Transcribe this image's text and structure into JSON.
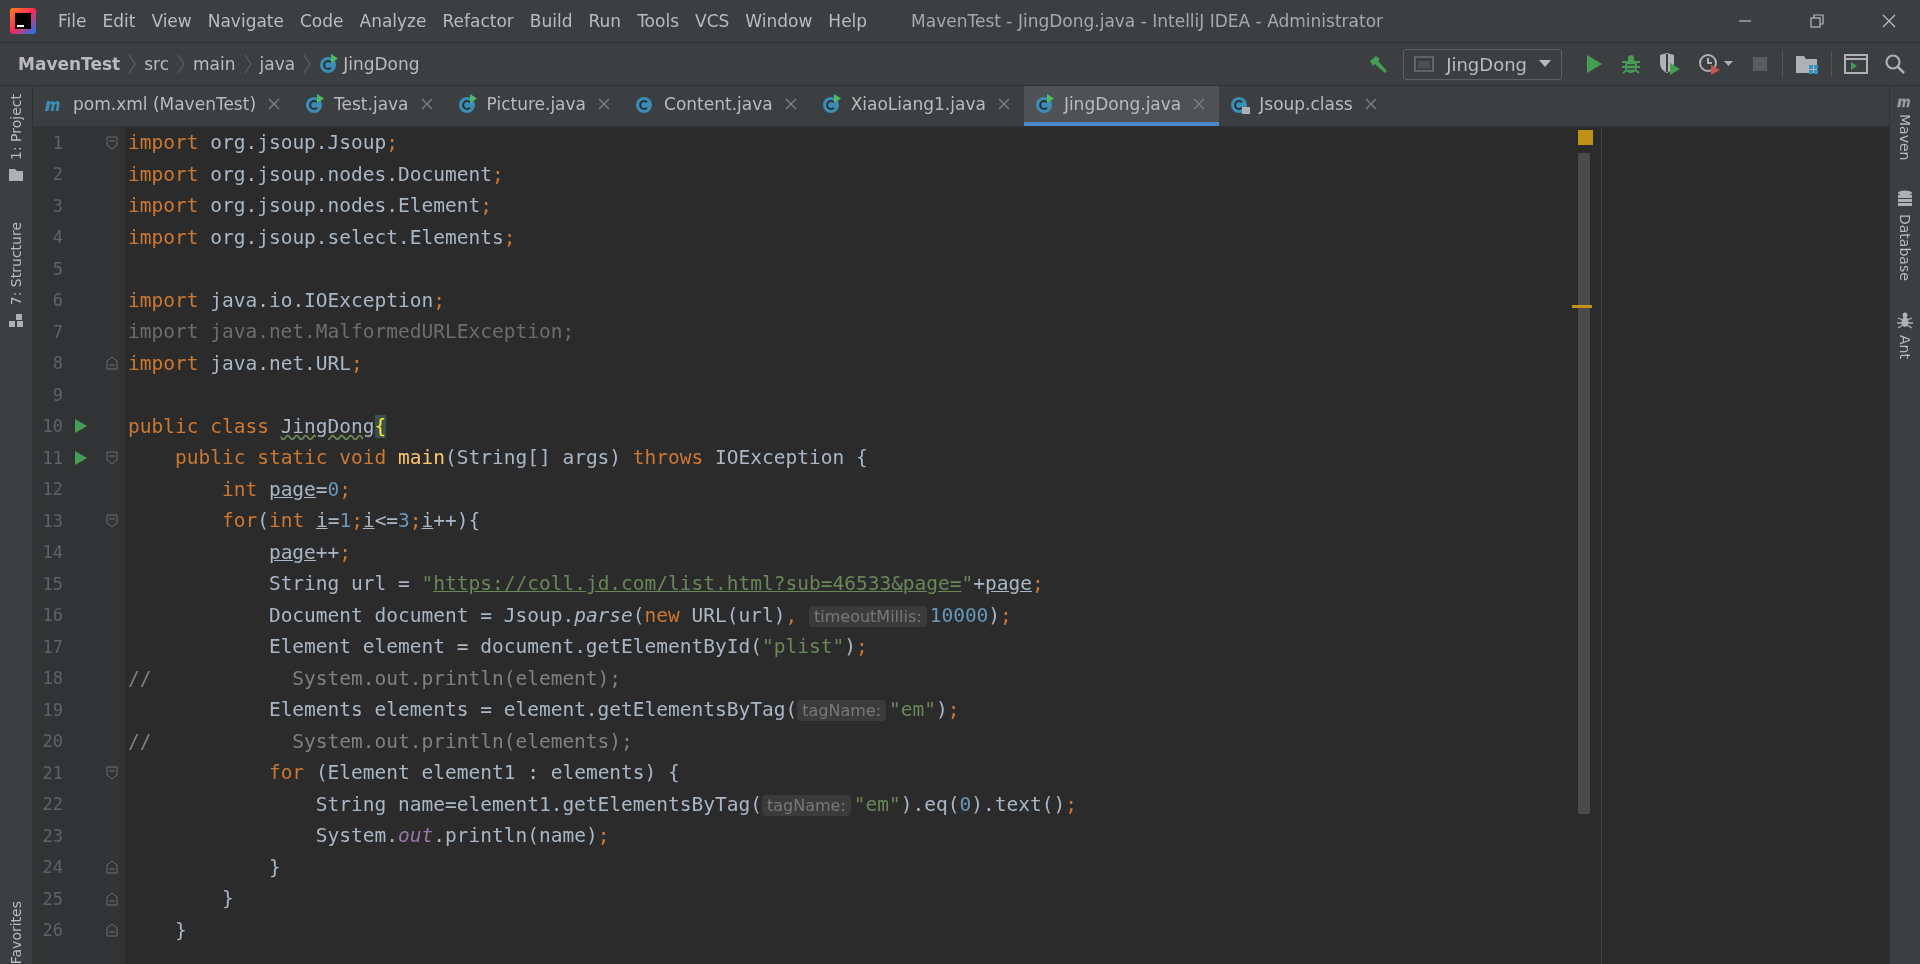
{
  "menu": [
    "File",
    "Edit",
    "View",
    "Navigate",
    "Code",
    "Analyze",
    "Refactor",
    "Build",
    "Run",
    "Tools",
    "VCS",
    "Window",
    "Help"
  ],
  "window_title": "MavenTest - JingDong.java - IntelliJ IDEA - Administrator",
  "breadcrumbs": [
    {
      "label": "MavenTest",
      "kind": "project"
    },
    {
      "label": "src",
      "kind": "folder"
    },
    {
      "label": "main",
      "kind": "folder"
    },
    {
      "label": "java",
      "kind": "folder"
    },
    {
      "label": "JingDong",
      "kind": "class"
    }
  ],
  "run_config": "JingDong",
  "tabs": [
    {
      "label": "pom.xml (MavenTest)",
      "kind": "maven",
      "selected": false
    },
    {
      "label": "Test.java",
      "kind": "runnable",
      "selected": false
    },
    {
      "label": "Picture.java",
      "kind": "runnable",
      "selected": false
    },
    {
      "label": "Content.java",
      "kind": "class",
      "selected": false
    },
    {
      "label": "XiaoLiang1.java",
      "kind": "runnable",
      "selected": false
    },
    {
      "label": "JingDong.java",
      "kind": "runnable",
      "selected": true
    },
    {
      "label": "Jsoup.class",
      "kind": "locked",
      "selected": false
    }
  ],
  "left_tools": [
    {
      "label": "1: Project",
      "kind": "folder"
    },
    {
      "label": "7: Structure",
      "kind": "structure"
    }
  ],
  "left_bottom_tools": [
    {
      "label": "Favorites"
    }
  ],
  "right_tools": [
    {
      "label": "Maven",
      "kind": "maven"
    },
    {
      "label": "Database",
      "kind": "database"
    },
    {
      "label": "Ant",
      "kind": "ant"
    }
  ],
  "editor": {
    "lines": [
      {
        "number": "1",
        "run": false,
        "fold_open": true,
        "fold_close": false,
        "tokens": [
          {
            "kind": "kw",
            "text": "import"
          },
          {
            "kind": "text",
            "text": " org.jsoup.Jsoup"
          },
          {
            "kind": "semi",
            "text": ";"
          }
        ]
      },
      {
        "number": "2",
        "run": false,
        "fold_open": false,
        "fold_close": false,
        "tokens": [
          {
            "kind": "kw",
            "text": "import"
          },
          {
            "kind": "text",
            "text": " org.jsoup.nodes.Document"
          },
          {
            "kind": "semi",
            "text": ";"
          }
        ]
      },
      {
        "number": "3",
        "run": false,
        "fold_open": false,
        "fold_close": false,
        "tokens": [
          {
            "kind": "kw",
            "text": "import"
          },
          {
            "kind": "text",
            "text": " org.jsoup.nodes.Element"
          },
          {
            "kind": "semi",
            "text": ";"
          }
        ]
      },
      {
        "number": "4",
        "run": false,
        "fold_open": false,
        "fold_close": false,
        "tokens": [
          {
            "kind": "kw",
            "text": "import"
          },
          {
            "kind": "text",
            "text": " org.jsoup.select.Elements"
          },
          {
            "kind": "semi",
            "text": ";"
          }
        ]
      },
      {
        "number": "5",
        "run": false,
        "fold_open": false,
        "fold_close": false
      },
      {
        "number": "6",
        "run": false,
        "fold_open": false,
        "fold_close": false,
        "tokens": [
          {
            "kind": "kw",
            "text": "import"
          },
          {
            "kind": "text",
            "text": " java.io.IOException"
          },
          {
            "kind": "semi",
            "text": ";"
          }
        ]
      },
      {
        "number": "7",
        "run": false,
        "fold_open": false,
        "fold_close": false,
        "tokens": [
          {
            "kind": "dim",
            "text": "import java.net.MalformedURLException;"
          }
        ]
      },
      {
        "number": "8",
        "run": false,
        "fold_open": false,
        "fold_close": true,
        "tokens": [
          {
            "kind": "kw",
            "text": "import"
          },
          {
            "kind": "text",
            "text": " java.net.URL"
          },
          {
            "kind": "semi",
            "text": ";"
          }
        ]
      },
      {
        "number": "9",
        "run": false,
        "fold_open": false,
        "fold_close": false
      },
      {
        "number": "10",
        "run": true,
        "fold_open": false,
        "fold_close": false,
        "tokens": [
          {
            "kind": "kw",
            "text": "public class "
          },
          {
            "kind": "cls",
            "text": "JingDong"
          },
          {
            "kind": "brace",
            "text": "{"
          }
        ]
      },
      {
        "number": "11",
        "run": true,
        "fold_open": true,
        "fold_close": false,
        "tokens": [
          {
            "kind": "kw",
            "text": "    public static void "
          },
          {
            "kind": "method",
            "text": "main"
          },
          {
            "kind": "text",
            "text": "(String[] args) "
          },
          {
            "kind": "kw",
            "text": "throws"
          },
          {
            "kind": "text",
            "text": " IOException {"
          }
        ]
      },
      {
        "number": "12",
        "run": false,
        "fold_open": false,
        "fold_close": false,
        "tokens": [
          {
            "kind": "kw",
            "text": "        int "
          },
          {
            "kind": "var",
            "text": "page"
          },
          {
            "kind": "text",
            "text": "="
          },
          {
            "kind": "num",
            "text": "0"
          },
          {
            "kind": "semi",
            "text": ";"
          }
        ]
      },
      {
        "number": "13",
        "run": false,
        "fold_open": true,
        "fold_close": false,
        "tokens": [
          {
            "kind": "kw",
            "text": "        for"
          },
          {
            "kind": "text",
            "text": "("
          },
          {
            "kind": "kw",
            "text": "int "
          },
          {
            "kind": "var",
            "text": "i"
          },
          {
            "kind": "text",
            "text": "="
          },
          {
            "kind": "num",
            "text": "1"
          },
          {
            "kind": "semi",
            "text": ";"
          },
          {
            "kind": "var",
            "text": "i"
          },
          {
            "kind": "text",
            "text": "<="
          },
          {
            "kind": "num",
            "text": "3"
          },
          {
            "kind": "semi",
            "text": ";"
          },
          {
            "kind": "var",
            "text": "i"
          },
          {
            "kind": "text",
            "text": "++){"
          }
        ]
      },
      {
        "number": "14",
        "run": false,
        "fold_open": false,
        "fold_close": false,
        "tokens": [
          {
            "kind": "var",
            "text": "            page"
          },
          {
            "kind": "text",
            "text": "++"
          },
          {
            "kind": "semi",
            "text": ";"
          }
        ]
      },
      {
        "number": "15",
        "run": false,
        "fold_open": false,
        "fold_close": false,
        "tokens": [
          {
            "kind": "text",
            "text": "            String url = "
          },
          {
            "kind": "str",
            "text": "\""
          },
          {
            "kind": "url",
            "text": "https://coll.jd.com/list.html?sub=46533&page="
          },
          {
            "kind": "str",
            "text": "\""
          },
          {
            "kind": "text",
            "text": "+"
          },
          {
            "kind": "var",
            "text": "page"
          },
          {
            "kind": "semi",
            "text": ";"
          }
        ]
      },
      {
        "number": "16",
        "run": false,
        "fold_open": false,
        "fold_close": false,
        "tokens": [
          {
            "kind": "text",
            "text": "            Document document = Jsoup."
          },
          {
            "kind": "static",
            "text": "parse"
          },
          {
            "kind": "text",
            "text": "("
          },
          {
            "kind": "kw",
            "text": "new"
          },
          {
            "kind": "text",
            "text": " URL(url)"
          },
          {
            "kind": "semi",
            "text": ", "
          },
          {
            "kind": "hint",
            "text": "timeoutMillis:"
          },
          {
            "kind": "num",
            "text": "10000"
          },
          {
            "kind": "text",
            "text": ")"
          },
          {
            "kind": "semi",
            "text": ";"
          }
        ]
      },
      {
        "number": "17",
        "run": false,
        "fold_open": false,
        "fold_close": false,
        "tokens": [
          {
            "kind": "text",
            "text": "            Element element = document.getElementById("
          },
          {
            "kind": "str",
            "text": "\"plist\""
          },
          {
            "kind": "text",
            "text": ")"
          },
          {
            "kind": "semi",
            "text": ";"
          }
        ]
      },
      {
        "number": "18",
        "run": false,
        "fold_open": false,
        "fold_close": false,
        "tokens": [
          {
            "kind": "comment",
            "text": "//            System.out.println(element);"
          }
        ]
      },
      {
        "number": "19",
        "run": false,
        "fold_open": false,
        "fold_close": false,
        "tokens": [
          {
            "kind": "text",
            "text": "            Elements elements = element.getElementsByTag("
          },
          {
            "kind": "hint",
            "text": "tagName:"
          },
          {
            "kind": "str",
            "text": "\"em\""
          },
          {
            "kind": "text",
            "text": ")"
          },
          {
            "kind": "semi",
            "text": ";"
          }
        ]
      },
      {
        "number": "20",
        "run": false,
        "fold_open": false,
        "fold_close": false,
        "tokens": [
          {
            "kind": "comment",
            "text": "//            System.out.println(elements);"
          }
        ]
      },
      {
        "number": "21",
        "run": false,
        "fold_open": true,
        "fold_close": false,
        "tokens": [
          {
            "kind": "kw",
            "text": "            for"
          },
          {
            "kind": "text",
            "text": " (Element element1 : elements) {"
          }
        ]
      },
      {
        "number": "22",
        "run": false,
        "fold_open": false,
        "fold_close": false,
        "tokens": [
          {
            "kind": "text",
            "text": "                String name=element1.getElementsByTag("
          },
          {
            "kind": "hint",
            "text": "tagName:"
          },
          {
            "kind": "str",
            "text": "\"em\""
          },
          {
            "kind": "text",
            "text": ").eq("
          },
          {
            "kind": "num",
            "text": "0"
          },
          {
            "kind": "text",
            "text": ").text()"
          },
          {
            "kind": "semi",
            "text": ";"
          }
        ]
      },
      {
        "number": "23",
        "run": false,
        "fold_open": false,
        "fold_close": false,
        "tokens": [
          {
            "kind": "text",
            "text": "                System."
          },
          {
            "kind": "field",
            "text": "out"
          },
          {
            "kind": "text",
            "text": ".println(name)"
          },
          {
            "kind": "semi",
            "text": ";"
          }
        ]
      },
      {
        "number": "24",
        "run": false,
        "fold_open": false,
        "fold_close": true,
        "tokens": [
          {
            "kind": "text",
            "text": "            }"
          }
        ]
      },
      {
        "number": "25",
        "run": false,
        "fold_open": false,
        "fold_close": true,
        "tokens": [
          {
            "kind": "text",
            "text": "        }"
          }
        ]
      },
      {
        "number": "26",
        "run": false,
        "fold_open": false,
        "fold_close": true,
        "tokens": [
          {
            "kind": "text",
            "text": "    }"
          }
        ]
      }
    ]
  }
}
